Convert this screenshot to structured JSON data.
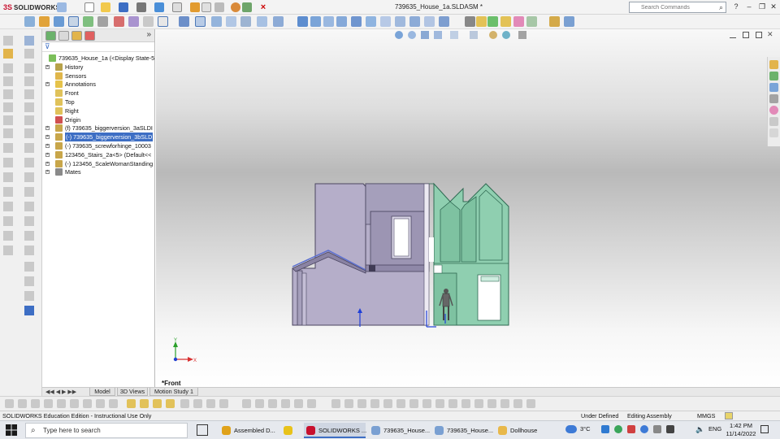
{
  "app": {
    "logo_ds": "3S",
    "logo_name": "SOLIDWORKS",
    "document_title": "739635_House_1a.SLDASM *",
    "search_placeholder": "Search Commands"
  },
  "feature_tree": {
    "filter_icon": "funnel-icon",
    "items": [
      {
        "label": "739635_House_1a  (<Display State-5",
        "icon": "assembly-icon",
        "expand": false
      },
      {
        "label": "History",
        "icon": "history-icon",
        "expand": true
      },
      {
        "label": "Sensors",
        "icon": "sensors-icon",
        "expand": false
      },
      {
        "label": "Annotations",
        "icon": "annotations-icon",
        "expand": true
      },
      {
        "label": "Front",
        "icon": "plane-icon",
        "expand": false
      },
      {
        "label": "Top",
        "icon": "plane-icon",
        "expand": false
      },
      {
        "label": "Right",
        "icon": "plane-icon",
        "expand": false
      },
      {
        "label": "Origin",
        "icon": "origin-icon",
        "expand": false
      },
      {
        "label": "(f) 739635_biggerversion_3aSLDI",
        "icon": "part-icon",
        "expand": true
      },
      {
        "label": "(-) 739635_biggerversion_3bSLD",
        "icon": "part-icon",
        "expand": true,
        "selected": true
      },
      {
        "label": "(-) 739635_screwforhinge_10003",
        "icon": "part-icon",
        "expand": true
      },
      {
        "label": "123456_Stairs_2a<5> (Default<<",
        "icon": "part-icon",
        "expand": true
      },
      {
        "label": "(-) 123456_ScaleWomanStanding",
        "icon": "part-icon",
        "expand": true
      },
      {
        "label": "Mates",
        "icon": "mates-icon",
        "expand": true
      }
    ]
  },
  "view": {
    "orientation_label": "*Front"
  },
  "bottom_tabs": [
    {
      "label": "Model",
      "active": true
    },
    {
      "label": "3D Views",
      "active": false
    },
    {
      "label": "Motion Study 1",
      "active": false
    }
  ],
  "status_bar": {
    "left": "SOLIDWORKS Education Edition - Instructional Use Only",
    "state": "Under Defined",
    "mode": "Editing Assembly",
    "units": "MMGS"
  },
  "taskbar": {
    "search_placeholder": "Type here to search",
    "apps": [
      {
        "label": "Assembled D...",
        "icon": "chrome-icon",
        "active": false
      },
      {
        "label": "",
        "icon": "x-app-icon",
        "active": false
      },
      {
        "label": "SOLIDWORKS ...",
        "icon": "solidworks-icon",
        "active": true
      },
      {
        "label": "739635_House...",
        "icon": "solidworks-doc-icon",
        "active": false
      },
      {
        "label": "739635_House...",
        "icon": "solidworks-doc-icon",
        "active": false
      },
      {
        "label": "Dollhouse",
        "icon": "folder-icon",
        "active": false
      }
    ],
    "weather": "3°C",
    "language": "ENG",
    "time": "1:42 PM",
    "date": "11/14/2022"
  },
  "colors": {
    "purple_wall": "#b5aec9",
    "purple_edge": "#4a4560",
    "green_wall": "#8fcfb0",
    "green_edge": "#2f6a52",
    "selection": "#3d6ec4",
    "accent_red": "#c8102e"
  }
}
